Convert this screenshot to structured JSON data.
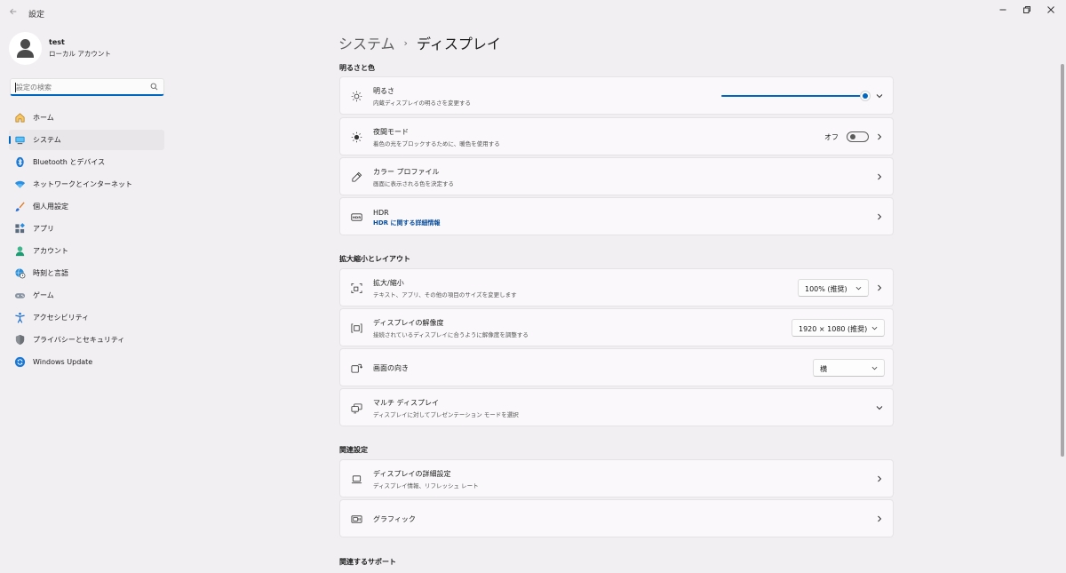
{
  "window": {
    "title": "設定"
  },
  "profile": {
    "name": "test",
    "account_type": "ローカル アカウント"
  },
  "search": {
    "placeholder": "設定の検索"
  },
  "sidebar": {
    "items": [
      {
        "label": "ホーム",
        "icon": "home-icon"
      },
      {
        "label": "システム",
        "icon": "monitor-icon",
        "active": true
      },
      {
        "label": "Bluetooth とデバイス",
        "icon": "bluetooth-icon"
      },
      {
        "label": "ネットワークとインターネット",
        "icon": "wifi-icon"
      },
      {
        "label": "個人用設定",
        "icon": "brush-icon"
      },
      {
        "label": "アプリ",
        "icon": "apps-icon"
      },
      {
        "label": "アカウント",
        "icon": "person-icon"
      },
      {
        "label": "時刻と言語",
        "icon": "globe-clock-icon"
      },
      {
        "label": "ゲーム",
        "icon": "gamepad-icon"
      },
      {
        "label": "アクセシビリティ",
        "icon": "accessibility-icon"
      },
      {
        "label": "プライバシーとセキュリティ",
        "icon": "shield-icon"
      },
      {
        "label": "Windows Update",
        "icon": "update-icon"
      }
    ]
  },
  "breadcrumb": {
    "parent": "システム",
    "separator": "›",
    "current": "ディスプレイ"
  },
  "sections": {
    "brightness_color": "明るさと色",
    "scale_layout": "拡大縮小とレイアウト",
    "related_settings": "関連設定",
    "related_support": "関連するサポート"
  },
  "brightness": {
    "title": "明るさ",
    "subtitle": "内蔵ディスプレイの明るさを変更する",
    "level_percent": 100
  },
  "night_light": {
    "title": "夜間モード",
    "subtitle": "着色の光をブロックするために、暖色を使用する",
    "toggle_label": "オフ",
    "on": false
  },
  "color_profile": {
    "title": "カラー プロファイル",
    "subtitle": "画面に表示される色を決定する"
  },
  "hdr": {
    "title": "HDR",
    "link": "HDR に関する詳細情報"
  },
  "scale": {
    "title": "拡大/縮小",
    "subtitle": "テキスト、アプリ、その他の項目のサイズを変更します",
    "value": "100% (推奨)"
  },
  "resolution": {
    "title": "ディスプレイの解像度",
    "subtitle": "接続されているディスプレイに合うように解像度を調整する",
    "value": "1920 × 1080 (推奨)"
  },
  "orientation": {
    "title": "画面の向き",
    "value": "横"
  },
  "multi_display": {
    "title": "マルチ ディスプレイ",
    "subtitle": "ディスプレイに対してプレゼンテーション モードを選択"
  },
  "advanced_display": {
    "title": "ディスプレイの詳細設定",
    "subtitle": "ディスプレイ情報、リフレッシュ レート"
  },
  "graphics": {
    "title": "グラフィック"
  },
  "colors": {
    "accent": "#0067c0",
    "background": "#f2eff3",
    "card": "#faf8fa"
  }
}
